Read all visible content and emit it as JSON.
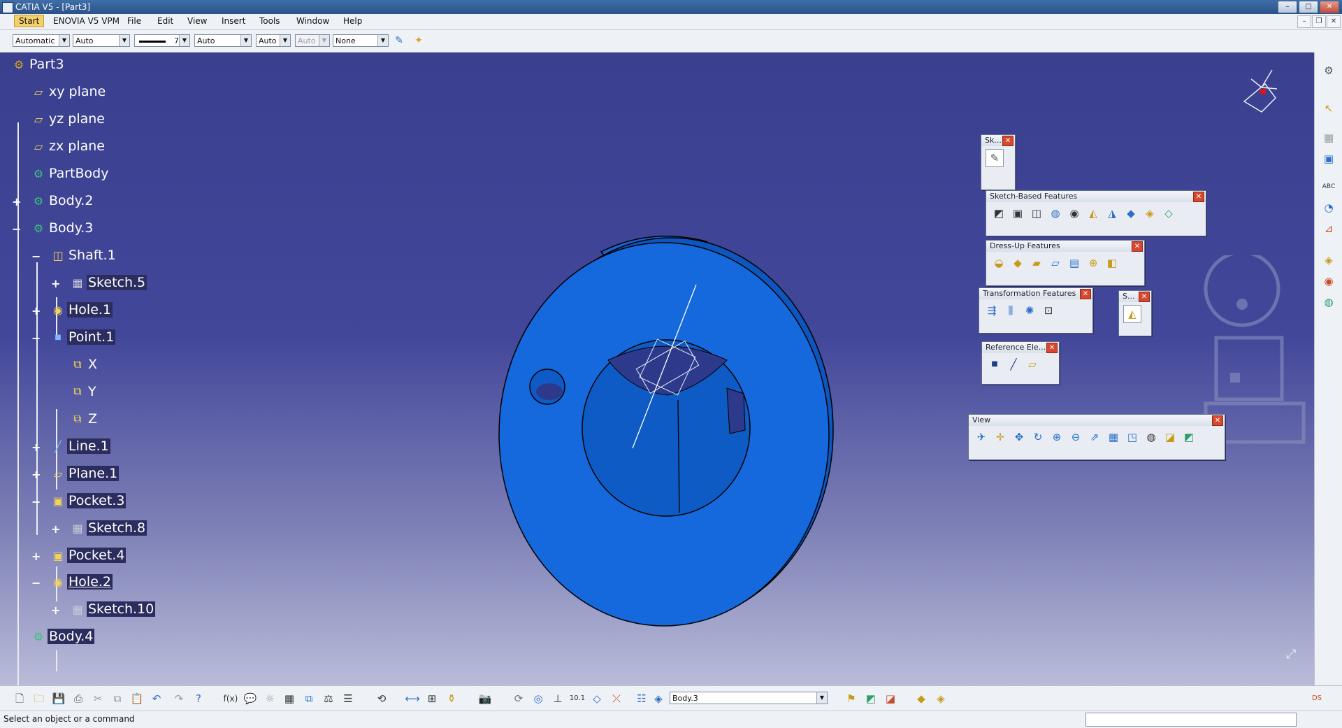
{
  "window": {
    "title": "CATIA V5 - [Part3]"
  },
  "menu": {
    "start": "Start",
    "items": [
      "ENOVIA V5 VPM",
      "File",
      "Edit",
      "View",
      "Insert",
      "Tools",
      "Window",
      "Help"
    ]
  },
  "format_bar": {
    "color": "Automatic",
    "transparency": "Auto",
    "line_weight": "7",
    "line_type": "Auto",
    "point_type": "Auto",
    "layer_disabled": "Auto",
    "layer": "None"
  },
  "tree": [
    {
      "label": "Part3",
      "icon": "part-icon"
    },
    {
      "label": "xy plane",
      "icon": "plane-icon"
    },
    {
      "label": "yz plane",
      "icon": "plane-icon"
    },
    {
      "label": "zx plane",
      "icon": "plane-icon"
    },
    {
      "label": "PartBody",
      "icon": "body-gear-icon"
    },
    {
      "label": "Body.2",
      "icon": "body-gear-icon"
    },
    {
      "label": "Body.3",
      "icon": "body-gear-icon"
    },
    {
      "label": "Shaft.1",
      "icon": "shaft-icon"
    },
    {
      "label": "Sketch.5",
      "icon": "sketch-icon"
    },
    {
      "label": "Hole.1",
      "icon": "hole-icon"
    },
    {
      "label": "Point.1",
      "icon": "point-icon"
    },
    {
      "label": "X",
      "icon": "parameter-icon"
    },
    {
      "label": "Y",
      "icon": "parameter-icon"
    },
    {
      "label": "Z",
      "icon": "parameter-icon"
    },
    {
      "label": "Line.1",
      "icon": "line-icon"
    },
    {
      "label": "Plane.1",
      "icon": "plane-icon"
    },
    {
      "label": "Pocket.3",
      "icon": "pocket-icon"
    },
    {
      "label": "Sketch.8",
      "icon": "sketch-icon"
    },
    {
      "label": "Pocket.4",
      "icon": "pocket-icon"
    },
    {
      "label": "Hole.2",
      "icon": "hole-icon"
    },
    {
      "label": "Sketch.10",
      "icon": "sketch-icon"
    },
    {
      "label": "Body.4",
      "icon": "body-gear-icon"
    }
  ],
  "toolbars": {
    "sketcher": "Sk...",
    "sketch_based": "Sketch-Based Features",
    "dress_up": "Dress-Up Features",
    "transformation": "Transformation Features",
    "surface_based": "S...",
    "reference": "Reference Ele...",
    "view": "View"
  },
  "bottom": {
    "current_body": "Body.3"
  },
  "status": {
    "text": "Select an object or a command"
  },
  "colors": {
    "part": "#1565d8",
    "background_top": "#3a3f8e",
    "background_bottom": "#b9bcd8"
  }
}
